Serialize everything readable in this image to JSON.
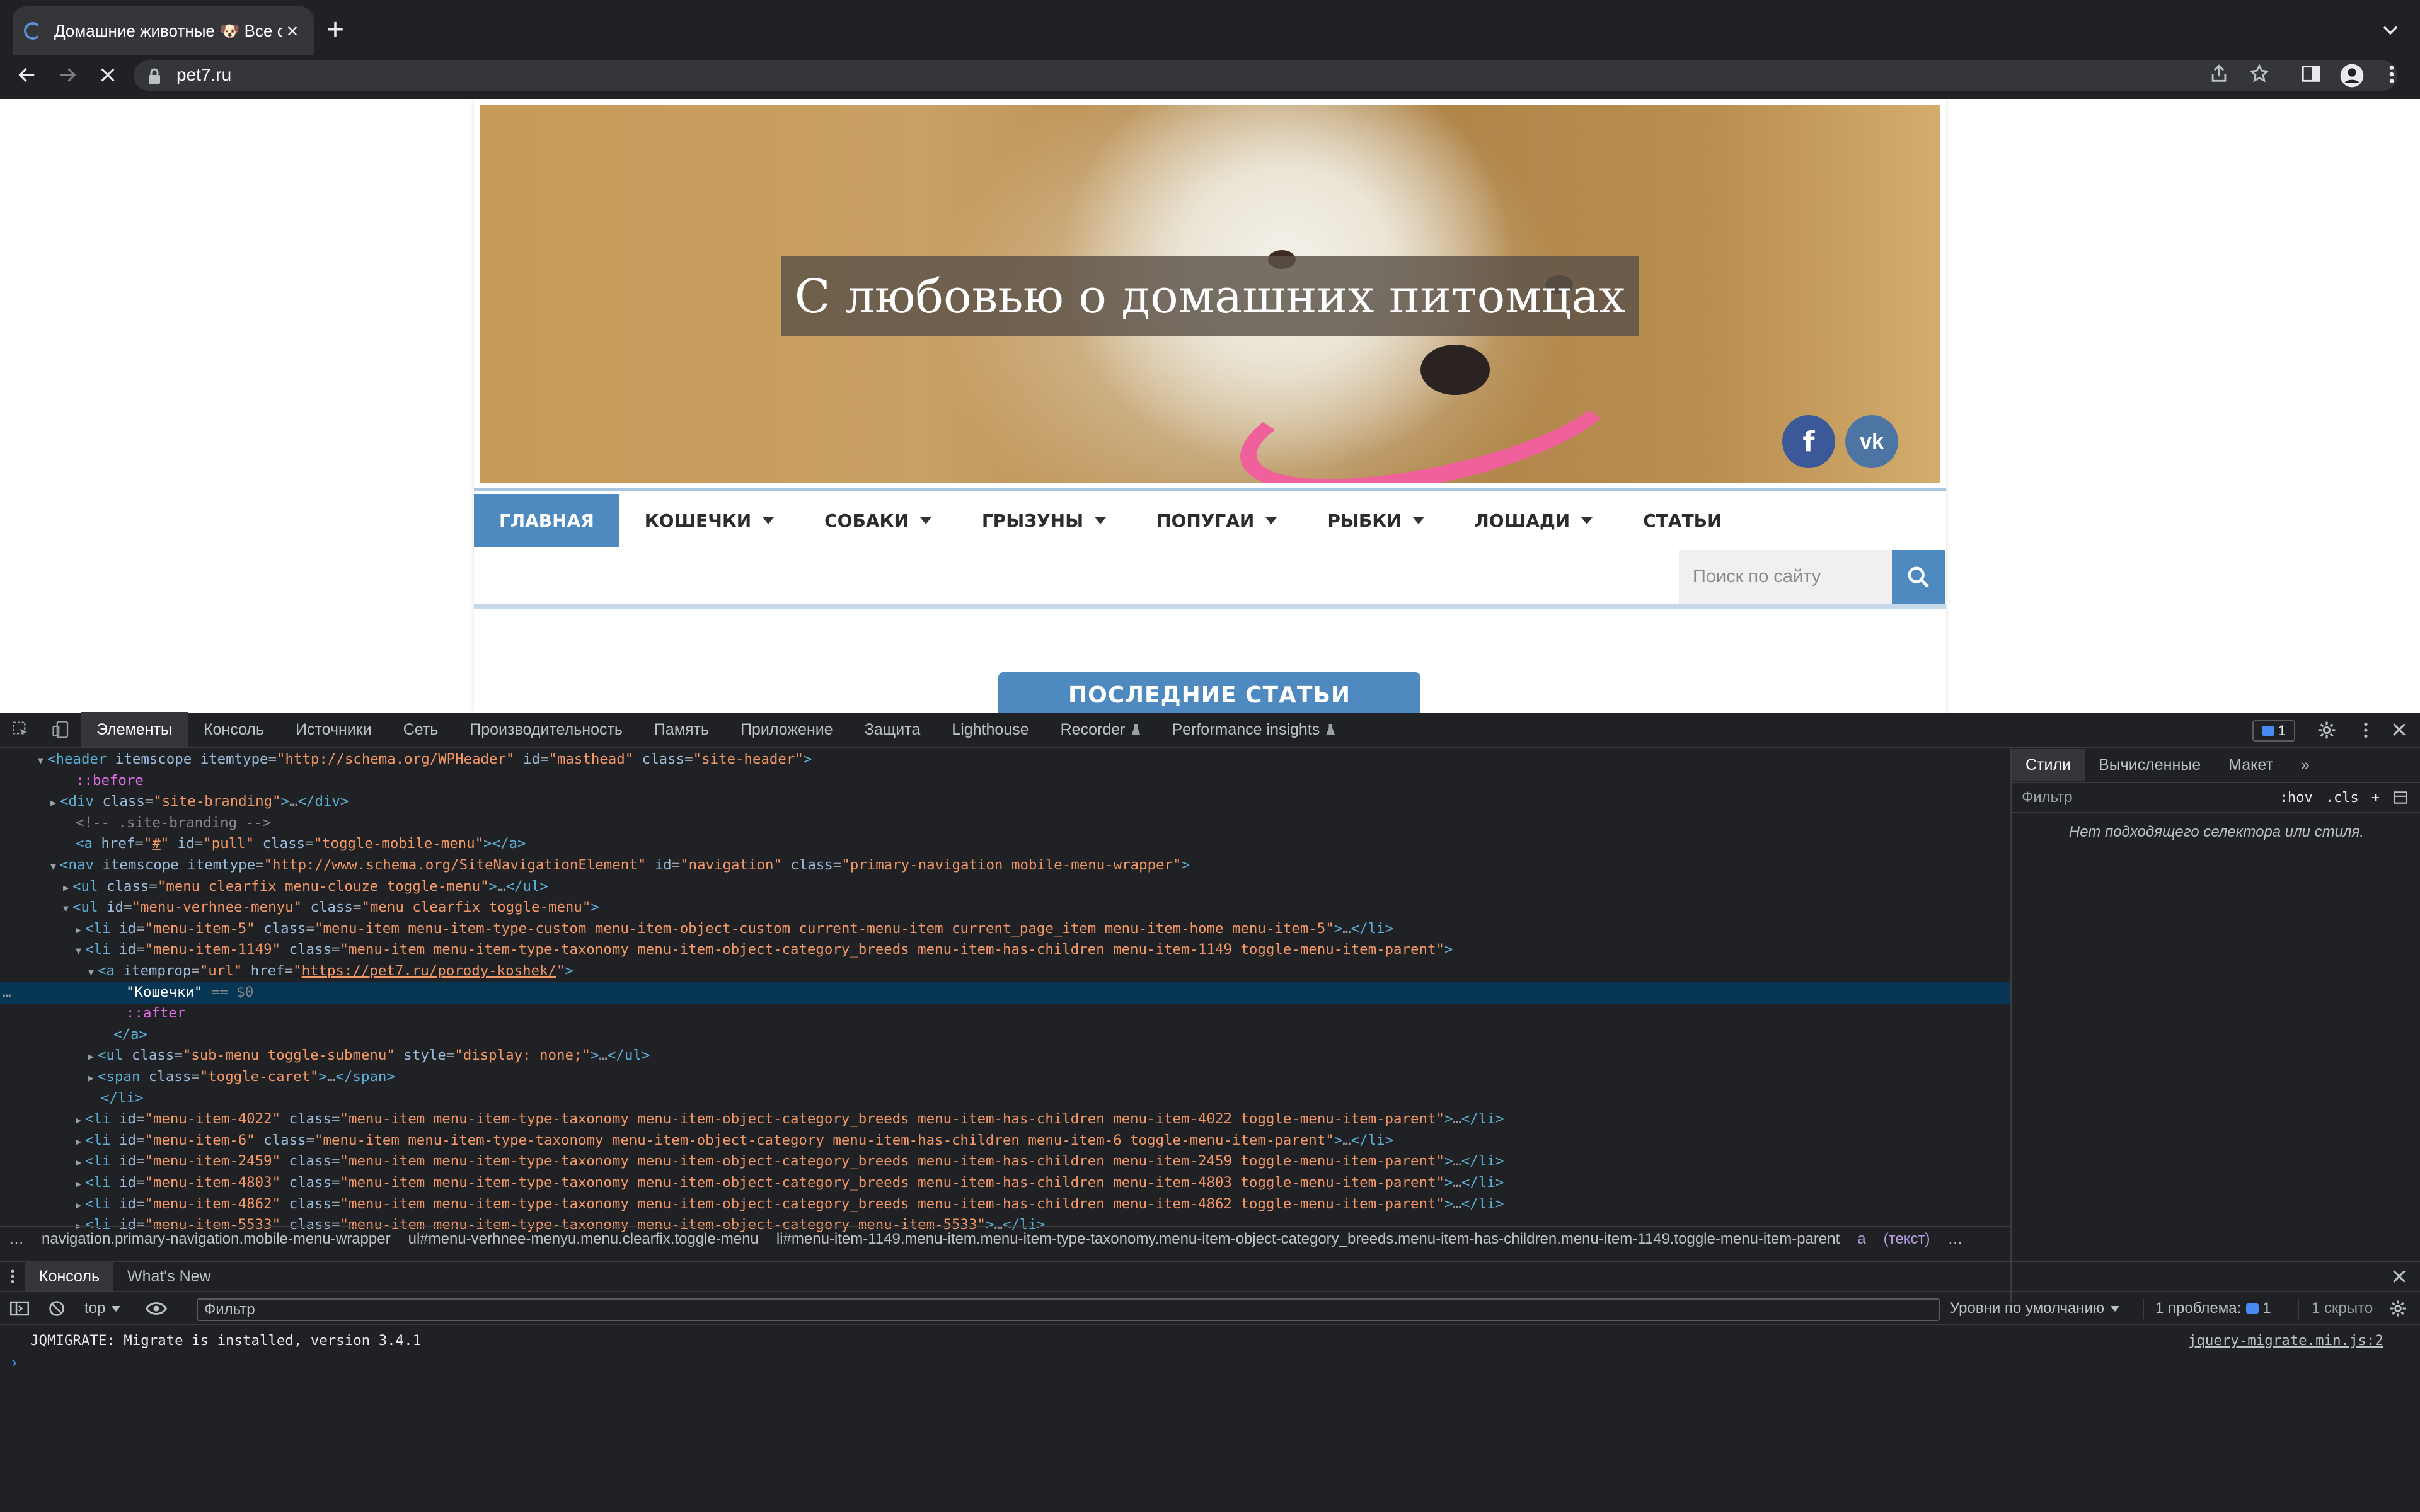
{
  "browser": {
    "tab_title": "Домашние животные 🐶 Все о",
    "url": "pet7.ru"
  },
  "site": {
    "hero_title": "С любовью о домашних питомцах",
    "social": {
      "facebook": "f",
      "vk": "vk"
    },
    "nav": [
      {
        "label": "ГЛАВНАЯ",
        "active": true,
        "has_sub": false
      },
      {
        "label": "КОШЕЧКИ",
        "active": false,
        "has_sub": true
      },
      {
        "label": "СОБАКИ",
        "active": false,
        "has_sub": true
      },
      {
        "label": "ГРЫЗУНЫ",
        "active": false,
        "has_sub": true
      },
      {
        "label": "ПОПУГАИ",
        "active": false,
        "has_sub": true
      },
      {
        "label": "РЫБКИ",
        "active": false,
        "has_sub": true
      },
      {
        "label": "ЛОШАДИ",
        "active": false,
        "has_sub": true
      },
      {
        "label": "СТАТЬИ",
        "active": false,
        "has_sub": false
      }
    ],
    "search_placeholder": "Поиск по сайту",
    "latest_heading": "ПОСЛЕДНИЕ СТАТЬИ",
    "accent_color": "#4e8abf"
  },
  "devtools": {
    "tabs": [
      "Элементы",
      "Консоль",
      "Источники",
      "Сеть",
      "Производительность",
      "Память",
      "Приложение",
      "Защита",
      "Lighthouse",
      "Recorder",
      "Performance insights"
    ],
    "issues_count": "1",
    "elements_lines": [
      {
        "indent": 4,
        "tri": "▼",
        "html": "<span class=\"tag\">&lt;header</span> <span class=\"an\">itemscope itemtype</span>=<span class=\"av\">\"http://schema.org/WPHeader\"</span> <span class=\"an\">id</span>=<span class=\"av\">\"masthead\"</span> <span class=\"an\">class</span>=<span class=\"av\">\"site-header\"</span><span class=\"tag\">&gt;</span>"
      },
      {
        "indent": 6,
        "tri": "",
        "html": "<span class=\"ps\">::before</span>"
      },
      {
        "indent": 5,
        "tri": "▶",
        "html": "<span class=\"tag\">&lt;div</span> <span class=\"an\">class</span>=<span class=\"av\">\"site-branding\"</span><span class=\"tag\">&gt;</span>…<span class=\"tag\">&lt;/div&gt;</span>"
      },
      {
        "indent": 6,
        "tri": "",
        "html": "<span class=\"cm\">&lt;!-- .site-branding --&gt;</span>"
      },
      {
        "indent": 6,
        "tri": "",
        "html": "<span class=\"tag\">&lt;a</span> <span class=\"an\">href</span>=<span class=\"av\">\"<u>#</u>\"</span> <span class=\"an\">id</span>=<span class=\"av\">\"pull\"</span> <span class=\"an\">class</span>=<span class=\"av\">\"toggle-mobile-menu\"</span><span class=\"tag\">&gt;&lt;/a&gt;</span>"
      },
      {
        "indent": 5,
        "tri": "▼",
        "html": "<span class=\"tag\">&lt;nav</span> <span class=\"an\">itemscope itemtype</span>=<span class=\"av\">\"http://www.schema.org/SiteNavigationElement\"</span> <span class=\"an\">id</span>=<span class=\"av\">\"navigation\"</span> <span class=\"an\">class</span>=<span class=\"av\">\"primary-navigation mobile-menu-wrapper\"</span><span class=\"tag\">&gt;</span>"
      },
      {
        "indent": 6,
        "tri": "▶",
        "html": "<span class=\"tag\">&lt;ul</span> <span class=\"an\">class</span>=<span class=\"av\">\"menu clearfix menu-clouze toggle-menu\"</span><span class=\"tag\">&gt;</span>…<span class=\"tag\">&lt;/ul&gt;</span>"
      },
      {
        "indent": 6,
        "tri": "▼",
        "html": "<span class=\"tag\">&lt;ul</span> <span class=\"an\">id</span>=<span class=\"av\">\"menu-verhnee-menyu\"</span> <span class=\"an\">class</span>=<span class=\"av\">\"menu clearfix toggle-menu\"</span><span class=\"tag\">&gt;</span>"
      },
      {
        "indent": 7,
        "tri": "▶",
        "html": "<span class=\"tag\">&lt;li</span> <span class=\"an\">id</span>=<span class=\"av\">\"menu-item-5\"</span> <span class=\"an\">class</span>=<span class=\"av\">\"menu-item menu-item-type-custom menu-item-object-custom current-menu-item current_page_item menu-item-home menu-item-5\"</span><span class=\"tag\">&gt;</span>…<span class=\"tag\">&lt;/li&gt;</span>"
      },
      {
        "indent": 7,
        "tri": "▼",
        "html": "<span class=\"tag\">&lt;li</span> <span class=\"an\">id</span>=<span class=\"av\">\"menu-item-1149\"</span> <span class=\"an\">class</span>=<span class=\"av\">\"menu-item menu-item-type-taxonomy menu-item-object-category_breeds menu-item-has-children menu-item-1149 toggle-menu-item-parent\"</span><span class=\"tag\">&gt;</span>"
      },
      {
        "indent": 8,
        "tri": "▼",
        "html": "<span class=\"tag\">&lt;a</span> <span class=\"an\">itemprop</span>=<span class=\"av\">\"url\"</span> <span class=\"an\">href</span>=<span class=\"av\">\"<span class=\"lk\">https://pet7.ru/porody-koshek/</span>\"</span><span class=\"tag\">&gt;</span>"
      },
      {
        "indent": 10,
        "tri": "",
        "sel": true,
        "html": "<span class=\"tx\">\"Кошечки\"</span> <span class=\"cm\">== $0</span>"
      },
      {
        "indent": 10,
        "tri": "",
        "html": "<span class=\"ps\">::after</span>"
      },
      {
        "indent": 9,
        "tri": "",
        "html": "<span class=\"tag\">&lt;/a&gt;</span>"
      },
      {
        "indent": 8,
        "tri": "▶",
        "html": "<span class=\"tag\">&lt;ul</span> <span class=\"an\">class</span>=<span class=\"av\">\"sub-menu toggle-submenu\"</span> <span class=\"an\">style</span>=<span class=\"av\">\"display: none;\"</span><span class=\"tag\">&gt;</span>…<span class=\"tag\">&lt;/ul&gt;</span>"
      },
      {
        "indent": 8,
        "tri": "▶",
        "html": "<span class=\"tag\">&lt;span</span> <span class=\"an\">class</span>=<span class=\"av\">\"toggle-caret\"</span><span class=\"tag\">&gt;</span>…<span class=\"tag\">&lt;/span&gt;</span>"
      },
      {
        "indent": 8,
        "tri": "",
        "html": "<span class=\"tag\">&lt;/li&gt;</span>"
      },
      {
        "indent": 7,
        "tri": "▶",
        "html": "<span class=\"tag\">&lt;li</span> <span class=\"an\">id</span>=<span class=\"av\">\"menu-item-4022\"</span> <span class=\"an\">class</span>=<span class=\"av\">\"menu-item menu-item-type-taxonomy menu-item-object-category_breeds menu-item-has-children menu-item-4022 toggle-menu-item-parent\"</span><span class=\"tag\">&gt;</span>…<span class=\"tag\">&lt;/li&gt;</span>"
      },
      {
        "indent": 7,
        "tri": "▶",
        "html": "<span class=\"tag\">&lt;li</span> <span class=\"an\">id</span>=<span class=\"av\">\"menu-item-6\"</span> <span class=\"an\">class</span>=<span class=\"av\">\"menu-item menu-item-type-taxonomy menu-item-object-category menu-item-has-children menu-item-6 toggle-menu-item-parent\"</span><span class=\"tag\">&gt;</span>…<span class=\"tag\">&lt;/li&gt;</span>"
      },
      {
        "indent": 7,
        "tri": "▶",
        "html": "<span class=\"tag\">&lt;li</span> <span class=\"an\">id</span>=<span class=\"av\">\"menu-item-2459\"</span> <span class=\"an\">class</span>=<span class=\"av\">\"menu-item menu-item-type-taxonomy menu-item-object-category_breeds menu-item-has-children menu-item-2459 toggle-menu-item-parent\"</span><span class=\"tag\">&gt;</span>…<span class=\"tag\">&lt;/li&gt;</span>"
      },
      {
        "indent": 7,
        "tri": "▶",
        "html": "<span class=\"tag\">&lt;li</span> <span class=\"an\">id</span>=<span class=\"av\">\"menu-item-4803\"</span> <span class=\"an\">class</span>=<span class=\"av\">\"menu-item menu-item-type-taxonomy menu-item-object-category_breeds menu-item-has-children menu-item-4803 toggle-menu-item-parent\"</span><span class=\"tag\">&gt;</span>…<span class=\"tag\">&lt;/li&gt;</span>"
      },
      {
        "indent": 7,
        "tri": "▶",
        "html": "<span class=\"tag\">&lt;li</span> <span class=\"an\">id</span>=<span class=\"av\">\"menu-item-4862\"</span> <span class=\"an\">class</span>=<span class=\"av\">\"menu-item menu-item-type-taxonomy menu-item-object-category_breeds menu-item-has-children menu-item-4862 toggle-menu-item-parent\"</span><span class=\"tag\">&gt;</span>…<span class=\"tag\">&lt;/li&gt;</span>"
      },
      {
        "indent": 7,
        "tri": "▶",
        "html": "<span class=\"tag\">&lt;li</span> <span class=\"an\">id</span>=<span class=\"av\">\"menu-item-5533\"</span> <span class=\"an\">class</span>=<span class=\"av\">\"menu-item menu-item-type-taxonomy menu-item-object-category menu-item-5533\"</span><span class=\"tag\">&gt;</span>…<span class=\"tag\">&lt;/li&gt;</span>"
      }
    ],
    "breadcrumbs": [
      "…",
      "navigation.primary-navigation.mobile-menu-wrapper",
      "ul#menu-verhnee-menyu.menu.clearfix.toggle-menu",
      "li#menu-item-1149.menu-item.menu-item-type-taxonomy.menu-item-object-category_breeds.menu-item-has-children.menu-item-1149.toggle-menu-item-parent",
      "a",
      "(текст)",
      "…"
    ],
    "styles": {
      "tabs": [
        "Стили",
        "Вычисленные",
        "Макет",
        "»"
      ],
      "filter_placeholder": "Фильтр",
      "hov": ":hov",
      "cls": ".cls",
      "empty_message": "Нет подходящего селектора или стиля."
    },
    "console": {
      "tabs": [
        "Консоль",
        "What's New"
      ],
      "context": "top",
      "filter_placeholder": "Фильтр",
      "levels": "Уровни по умолчанию",
      "problems": "1 проблема:",
      "problems_count": "1",
      "hidden": "1 скрыто",
      "message": "JQMIGRATE: Migrate is installed, version 3.4.1",
      "message_source": "jquery-migrate.min.js:2",
      "prompt": "›"
    }
  }
}
